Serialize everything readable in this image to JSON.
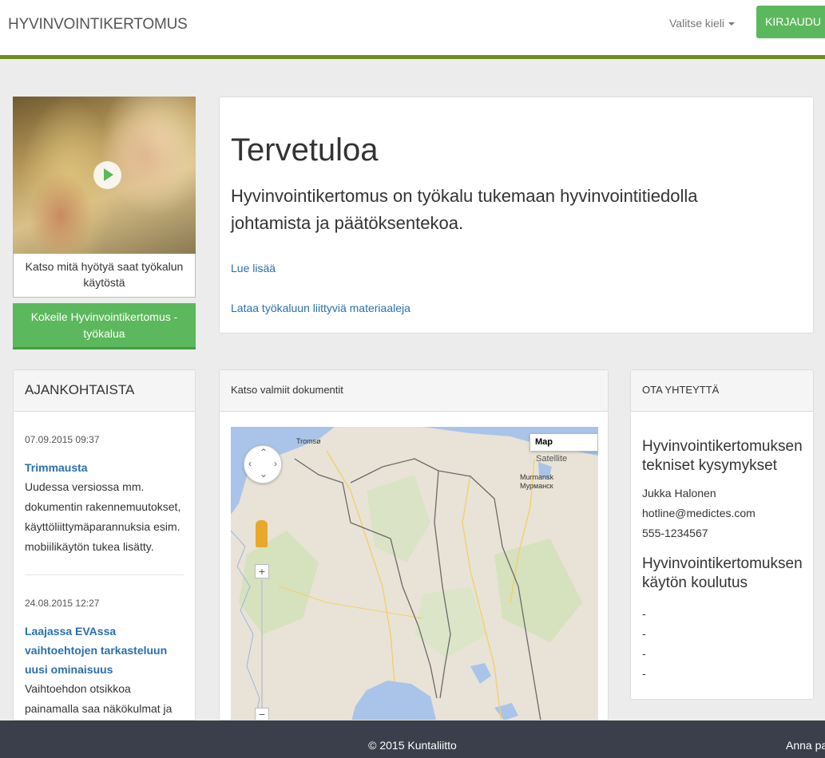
{
  "header": {
    "brand": "HYVINVOINTIKERTOMUS",
    "language_label": "Valitse kieli",
    "login_label": "KIRJAUDU",
    "accent_color": "#6e8e19",
    "login_color": "#5cb85c"
  },
  "video": {
    "caption": "Katso mitä hyötyä saat työkalun käytöstä",
    "try_button": "Kokeile Hyvinvointikertomus -työkalua"
  },
  "welcome": {
    "title": "Tervetuloa",
    "lead": "Hyvinvointikertomus on työkalu tukemaan hyvinvointitiedolla johtamista ja päätöksentekoa.",
    "read_more": "Lue lisää",
    "download": "Lataa työkaluun liittyviä materiaaleja"
  },
  "news": {
    "title": "AJANKOHTAISTA",
    "items": [
      {
        "date": "07.09.2015 09:37",
        "title": "Trimmausta",
        "text": "Uudessa versiossa mm. dokumentin rakennemuutokset, käyttöliittymäparannuksia esim. mobiilikäytön tukea lisätty."
      },
      {
        "date": "24.08.2015 12:27",
        "title": "Laajassa EVAssa vaihtoehtojen tarkasteluun uusi ominaisuus",
        "text": "Vaihtoehdon otsikkoa painamalla saa näkökulmat ja vaikutuskohteet piiloon ja takaisin."
      }
    ]
  },
  "documents": {
    "title": "Katso valmiit dokumentit",
    "map": {
      "type_map": "Map",
      "type_satellite": "Satellite",
      "city_tromso": "Tromsø",
      "city_murmansk": "Murmansk",
      "city_murmansk_ru": "Мурманск",
      "zoom_in": "+",
      "zoom_out": "−"
    }
  },
  "contact": {
    "title": "OTA YHTEYTTÄ",
    "tech_heading": "Hyvinvointikertomuksen tekniset kysymykset",
    "person": "Jukka Halonen",
    "email": "hotline@medictes.com",
    "phone": "555-1234567",
    "training_heading": "Hyvinvointikertomuksen käytön koulutus",
    "training_items": [
      "-",
      "-",
      "-",
      "-"
    ]
  },
  "footer": {
    "copyright": "© 2015 Kuntaliitto",
    "feedback": "Anna palautetta"
  }
}
